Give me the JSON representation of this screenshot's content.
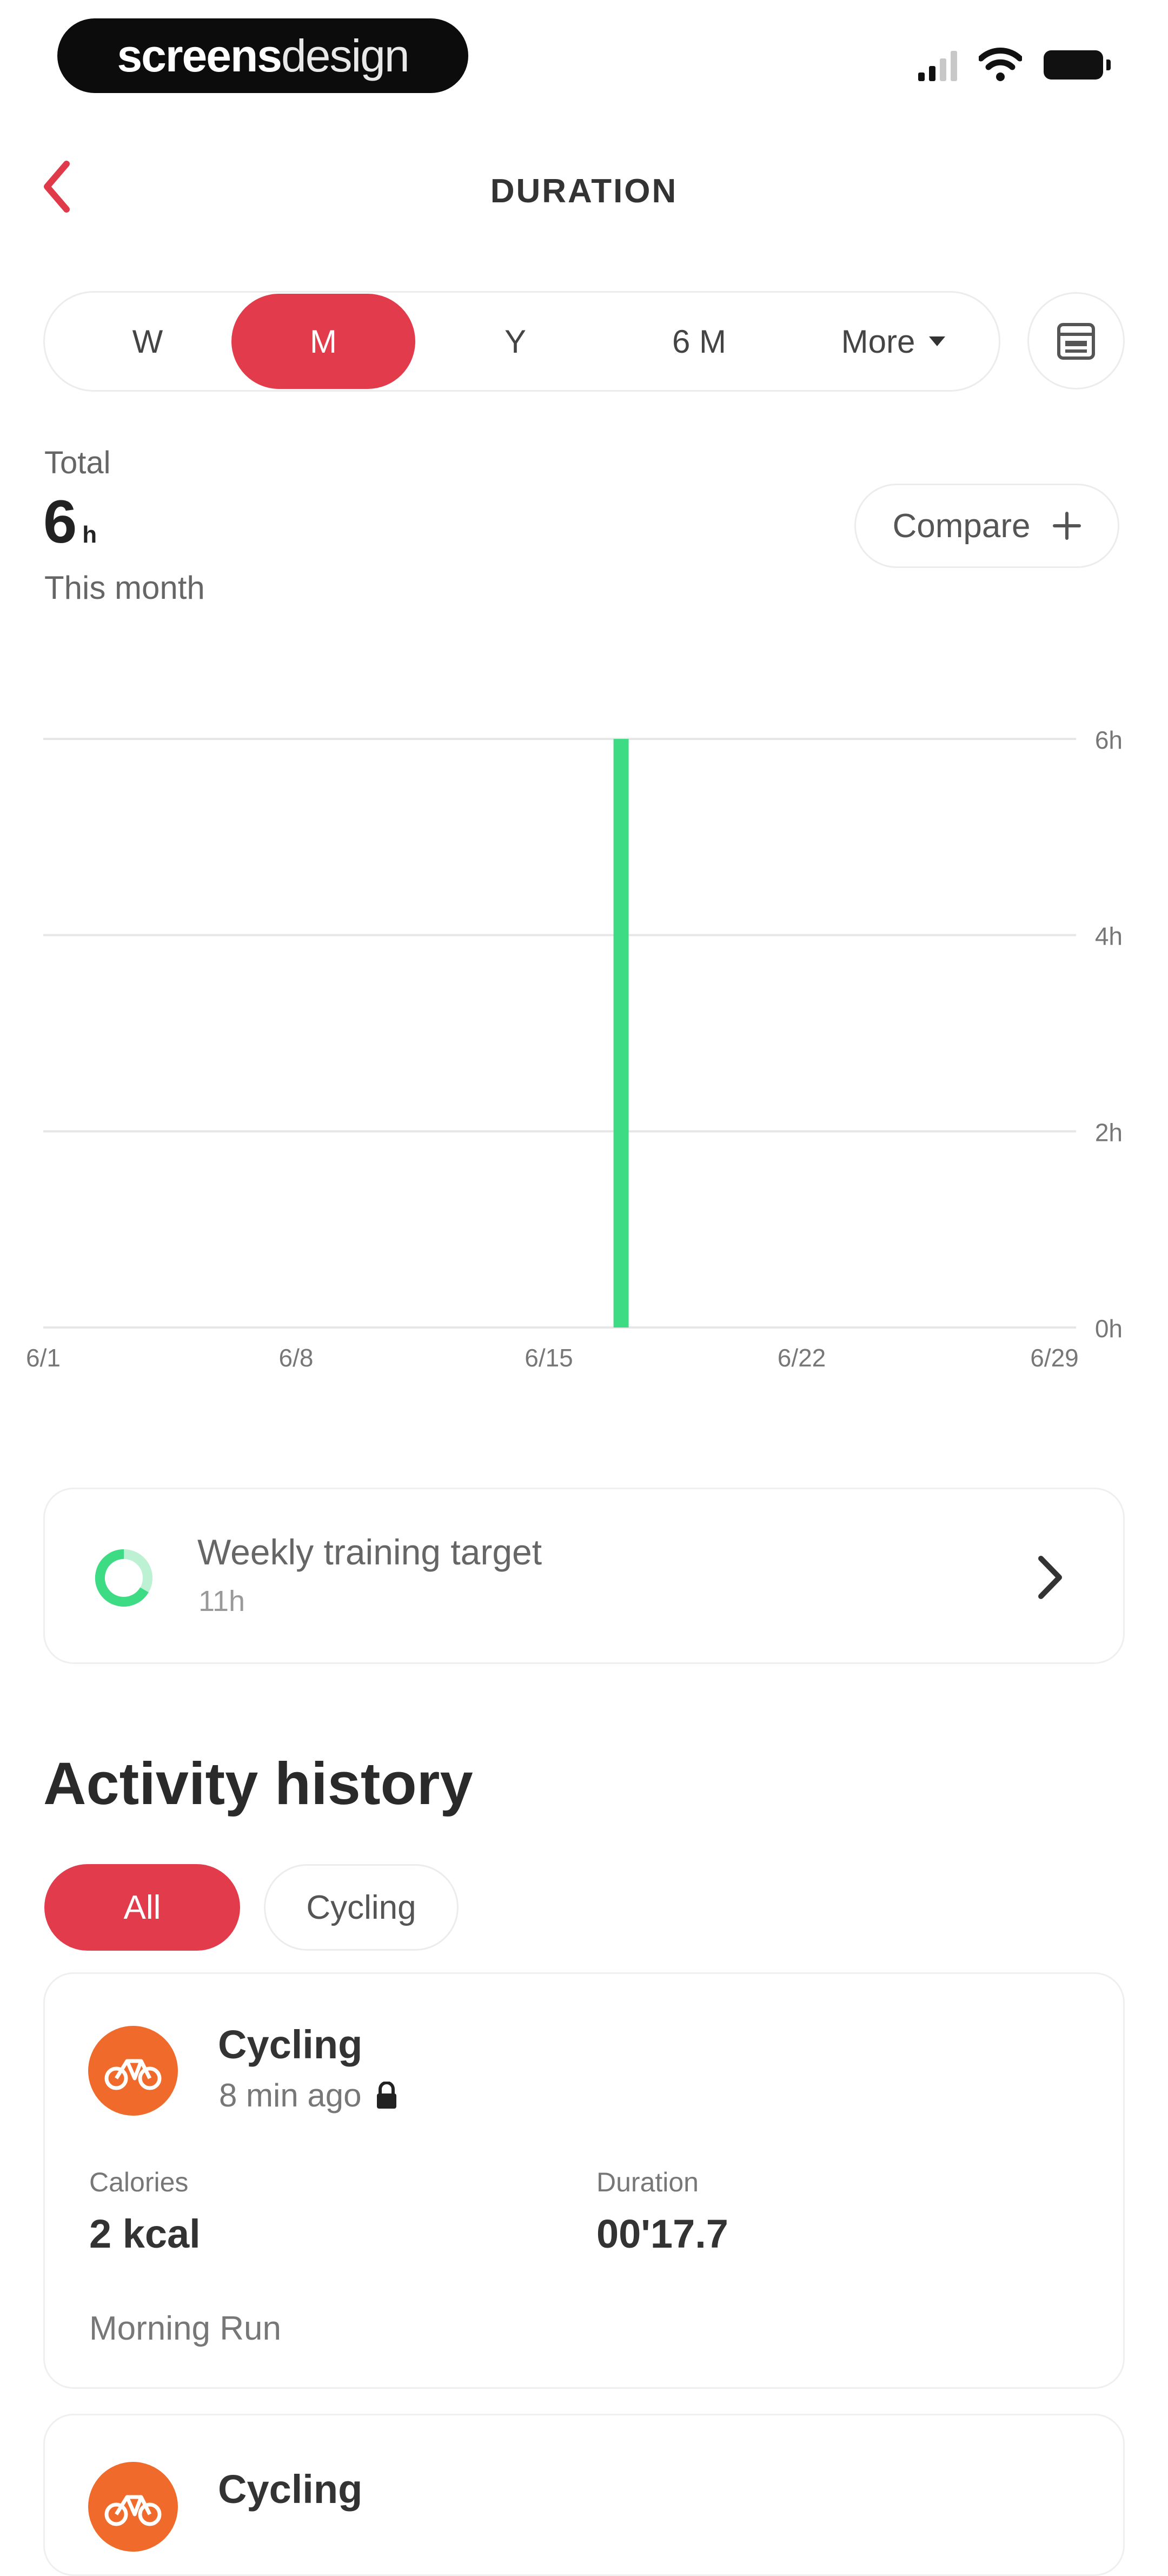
{
  "status_bar": {
    "brand_bold": "screens",
    "brand_light": "design"
  },
  "header": {
    "title": "DURATION"
  },
  "periods": [
    "W",
    "M",
    "Y",
    "6 M",
    "More"
  ],
  "summary": {
    "label": "Total",
    "value": "6",
    "unit": "h",
    "period": "This month",
    "compare_label": "Compare"
  },
  "chart_data": {
    "type": "bar",
    "x_ticks": [
      "6/1",
      "6/8",
      "6/15",
      "6/22",
      "6/29"
    ],
    "y_ticks": [
      "0h",
      "2h",
      "4h",
      "6h"
    ],
    "ylim": [
      0,
      6
    ],
    "bars": [
      {
        "date": "6/17",
        "value": 6
      }
    ],
    "colors": {
      "bar": "#3ddc84",
      "grid": "#e6e6e6"
    }
  },
  "weekly_target": {
    "title": "Weekly training target",
    "value": "11h"
  },
  "activity_history": {
    "title": "Activity history",
    "filters": [
      "All",
      "Cycling"
    ],
    "items": [
      {
        "name": "Cycling",
        "time": "8 min ago",
        "calories_label": "Calories",
        "calories_value": "2 kcal",
        "duration_label": "Duration",
        "duration_value": "00'17.7",
        "note": "Morning Run"
      },
      {
        "name": "Cycling"
      }
    ]
  },
  "colors": {
    "accent": "#e23b4b",
    "activity_orange": "#f06a2b",
    "chart_green": "#3ddc84"
  }
}
